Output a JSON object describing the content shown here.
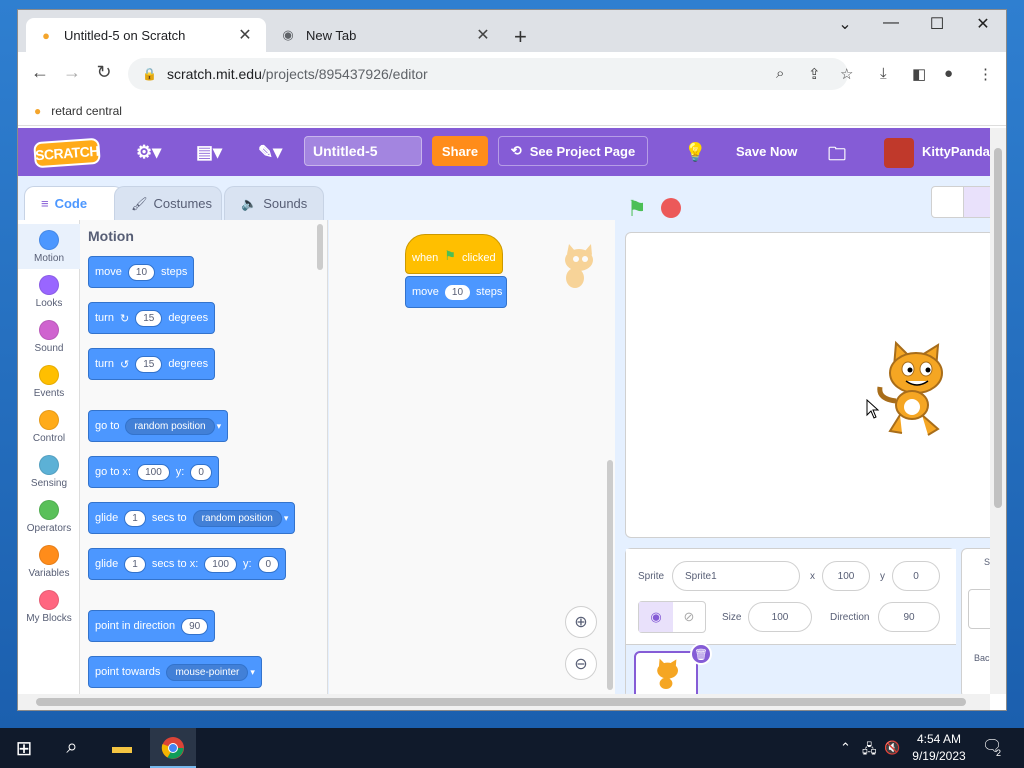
{
  "browser": {
    "tabs": [
      {
        "title": "Untitled-5 on Scratch",
        "favicon": "scratch-icon"
      },
      {
        "title": "New Tab",
        "favicon": "chrome-icon"
      }
    ],
    "new_tab_glyph": "+",
    "address": {
      "host": "scratch.mit.edu",
      "path": "/projects/895437926/editor"
    },
    "bookmarks": [
      {
        "label": "retard central"
      }
    ]
  },
  "menubar": {
    "logo": "SCRATCH",
    "project_title": "Untitled-5",
    "share": "Share",
    "see_project_page": "See Project Page",
    "save_now": "Save Now",
    "username": "KittyPanda5"
  },
  "editor_tabs": [
    "Code",
    "Costumes",
    "Sounds"
  ],
  "categories": [
    {
      "label": "Motion",
      "color": "#4c97ff"
    },
    {
      "label": "Looks",
      "color": "#9966ff"
    },
    {
      "label": "Sound",
      "color": "#cf63cf"
    },
    {
      "label": "Events",
      "color": "#ffbf00"
    },
    {
      "label": "Control",
      "color": "#ffab19"
    },
    {
      "label": "Sensing",
      "color": "#5cb1d6"
    },
    {
      "label": "Operators",
      "color": "#59c059"
    },
    {
      "label": "Variables",
      "color": "#ff8c1a"
    },
    {
      "label": "My Blocks",
      "color": "#ff6680"
    }
  ],
  "palette": {
    "heading": "Motion",
    "blocks": {
      "move": {
        "a": "move",
        "n": "10",
        "b": "steps"
      },
      "turn_cw": {
        "a": "turn",
        "n": "15",
        "b": "degrees"
      },
      "turn_ccw": {
        "a": "turn",
        "n": "15",
        "b": "degrees"
      },
      "goto": {
        "a": "go to",
        "d": "random position"
      },
      "goto_xy": {
        "a": "go to x:",
        "x": "100",
        "b": "y:",
        "y": "0"
      },
      "glide": {
        "a": "glide",
        "n": "1",
        "b": "secs to",
        "d": "random position"
      },
      "glide_xy": {
        "a": "glide",
        "n": "1",
        "b": "secs to x:",
        "x": "100",
        "c": "y:",
        "y": "0"
      },
      "point_dir": {
        "a": "point in direction",
        "n": "90"
      },
      "point_towards": {
        "a": "point towards",
        "d": "mouse-pointer"
      }
    }
  },
  "script": {
    "hat": {
      "a": "when",
      "b": "clicked"
    },
    "move": {
      "a": "move",
      "n": "10",
      "b": "steps"
    }
  },
  "sprite_info": {
    "sprite_label": "Sprite",
    "sprite_name": "Sprite1",
    "x_label": "x",
    "x": "100",
    "y_label": "y",
    "y": "0",
    "size_label": "Size",
    "size": "100",
    "direction_label": "Direction",
    "direction": "90"
  },
  "stage_selector": {
    "s": "S",
    "backdrops": "Bac"
  },
  "taskbar": {
    "time": "4:54 AM",
    "date": "9/19/2023",
    "notifications": "2"
  }
}
